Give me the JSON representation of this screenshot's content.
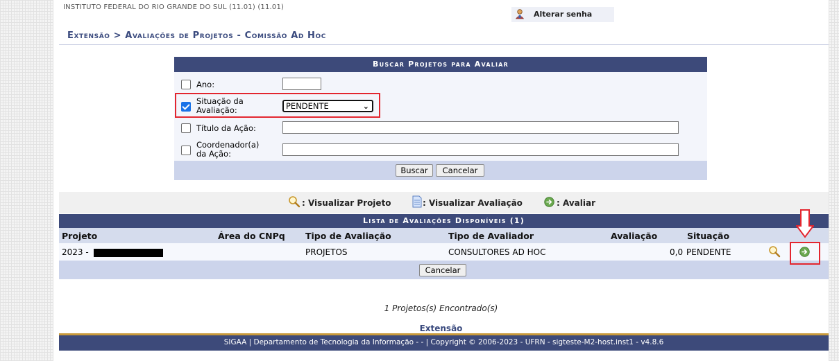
{
  "header": {
    "institution": "INSTITUTO FEDERAL DO RIO GRANDE DO SUL (11.01) (11.01)",
    "change_password": "Alterar senha"
  },
  "breadcrumb": "Extensão > Avaliações de Projetos - Comissão Ad Hoc",
  "search_form": {
    "title": "Buscar Projetos para Avaliar",
    "fields": [
      {
        "label": "Ano:",
        "checked": false,
        "value": ""
      },
      {
        "label_line1": "Situação da",
        "label_line2": "Avaliação:",
        "checked": true,
        "value": "PENDENTE"
      },
      {
        "label": "Título da Ação:",
        "checked": false,
        "value": ""
      },
      {
        "label_line1": "Coordenador(a)",
        "label_line2": "da Ação:",
        "checked": false,
        "value": ""
      }
    ],
    "search_button": "Buscar",
    "cancel_button": "Cancelar"
  },
  "legend": {
    "view_project": ": Visualizar Projeto",
    "view_evaluation": ": Visualizar Avaliação",
    "evaluate": ": Avaliar"
  },
  "list": {
    "title": "Lista de Avaliações Disponíveis (1)",
    "columns": [
      "Projeto",
      "Área do CNPq",
      "Tipo de Avaliação",
      "Tipo de Avaliador",
      "Avaliação",
      "Situação"
    ],
    "rows": [
      {
        "projeto": "2023 -",
        "area": "",
        "tipo_avaliacao": "PROJETOS",
        "tipo_avaliador": "CONSULTORES AD HOC",
        "avaliacao": "0,0",
        "situacao": "PENDENTE"
      }
    ],
    "cancel_button": "Cancelar"
  },
  "found_text": "1 Projetos(s) Encontrado(s)",
  "module_link": "Extensão",
  "footer": "SIGAA | Departamento de Tecnologia da Informação - - | Copyright © 2006-2023 - UFRN - sigteste-M2-host.inst1 - v4.8.6",
  "colors": {
    "header_blue": "#3d4a7a",
    "highlight_red": "#e3262f",
    "footer_gold": "#c99a3b"
  }
}
